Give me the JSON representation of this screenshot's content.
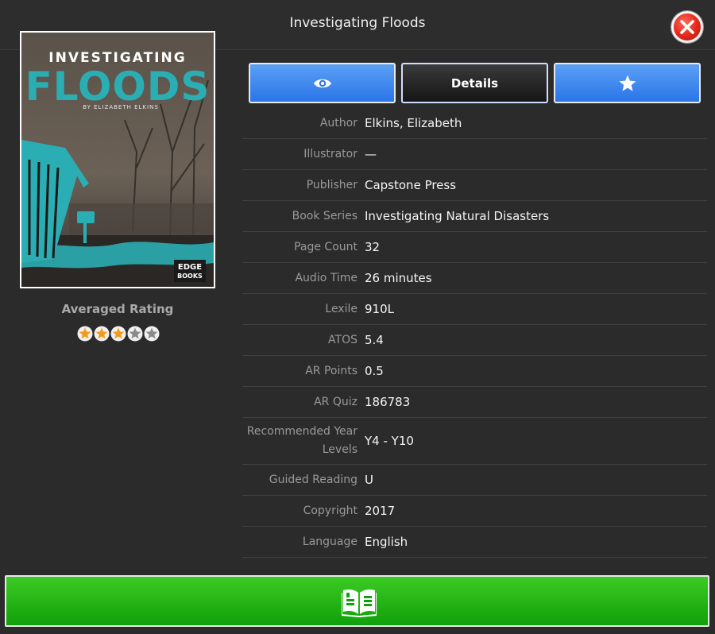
{
  "window": {
    "title": "Investigating Floods"
  },
  "cover": {
    "title_top": "INVESTIGATING",
    "title_main": "FLOODS",
    "byline": "BY ELIZABETH ELKINS",
    "imprint_line1": "EDGE",
    "imprint_line2": "BOOKS"
  },
  "rating": {
    "label": "Averaged Rating",
    "value": 3,
    "max": 5
  },
  "buttons": {
    "preview_icon": "eye-icon",
    "details_label": "Details",
    "favorite_icon": "star-icon",
    "read_icon": "open-book-icon"
  },
  "details": [
    {
      "key": "Author",
      "value": "Elkins, Elizabeth"
    },
    {
      "key": "Illustrator",
      "value": "—"
    },
    {
      "key": "Publisher",
      "value": "Capstone Press"
    },
    {
      "key": "Book Series",
      "value": "Investigating Natural Disasters"
    },
    {
      "key": "Page Count",
      "value": "32"
    },
    {
      "key": "Audio Time",
      "value": "26 minutes"
    },
    {
      "key": "Lexile",
      "value": "910L"
    },
    {
      "key": "ATOS",
      "value": "5.4"
    },
    {
      "key": "AR Points",
      "value": "0.5"
    },
    {
      "key": "AR Quiz",
      "value": "186783"
    },
    {
      "key": "Recommended Year Levels",
      "value": "Y4 - Y10"
    },
    {
      "key": "Guided Reading",
      "value": "U"
    },
    {
      "key": "Copyright",
      "value": "2017"
    },
    {
      "key": "Language",
      "value": "English"
    }
  ],
  "colors": {
    "accent_blue": "#2a75e8",
    "read_green": "#10a00a",
    "star_filled": "#f39a1e",
    "star_empty": "#8a8a8a",
    "teal": "#2aaeb4"
  }
}
